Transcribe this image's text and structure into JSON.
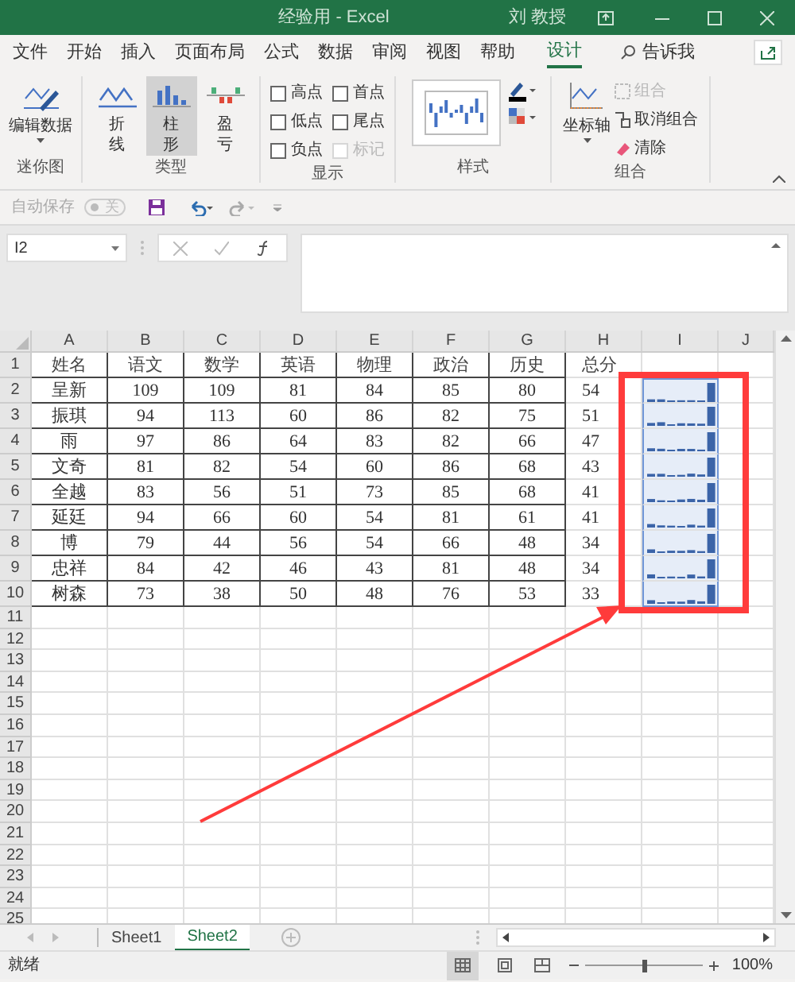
{
  "window": {
    "title": "经验用 - Excel",
    "user": "刘 教授"
  },
  "ribbon_tabs": [
    {
      "label": "文件",
      "selected": false
    },
    {
      "label": "开始",
      "selected": false
    },
    {
      "label": "插入",
      "selected": false
    },
    {
      "label": "页面布局",
      "selected": false
    },
    {
      "label": "公式",
      "selected": false
    },
    {
      "label": "数据",
      "selected": false
    },
    {
      "label": "审阅",
      "selected": false
    },
    {
      "label": "视图",
      "selected": false
    },
    {
      "label": "帮助",
      "selected": false
    },
    {
      "label": "设计",
      "selected": true
    }
  ],
  "tell_me": "告诉我",
  "sparkline_group": {
    "button": "编辑数据",
    "label": "迷你图"
  },
  "type_group": {
    "label": "类型",
    "types": [
      {
        "kind": "line",
        "label": "折线",
        "selected": false
      },
      {
        "kind": "column",
        "label": "柱形",
        "selected": true
      },
      {
        "kind": "winloss",
        "label": "盈亏",
        "selected": false
      }
    ]
  },
  "show_group": {
    "label": "显示",
    "options": [
      {
        "label": "高点",
        "checked": false,
        "disabled": false
      },
      {
        "label": "低点",
        "checked": false,
        "disabled": false
      },
      {
        "label": "负点",
        "checked": false,
        "disabled": false
      },
      {
        "label": "首点",
        "checked": false,
        "disabled": false
      },
      {
        "label": "尾点",
        "checked": false,
        "disabled": false
      },
      {
        "label": "标记",
        "checked": false,
        "disabled": true
      }
    ]
  },
  "style_group": {
    "label": "样式"
  },
  "group_group": {
    "label": "组合",
    "axis": "坐标轴",
    "items": [
      {
        "kind": "group",
        "label": "组合",
        "disabled": true
      },
      {
        "kind": "ungroup",
        "label": "取消组合",
        "disabled": false
      },
      {
        "kind": "clear",
        "label": "清除",
        "disabled": false
      }
    ]
  },
  "quick_access": {
    "autosave_label": "自动保存",
    "autosave_on": false,
    "autosave_state": "关"
  },
  "formula_bar": {
    "name_box": "I2"
  },
  "sheet": {
    "columns": [
      "A",
      "B",
      "C",
      "D",
      "E",
      "F",
      "G",
      "H",
      "I",
      "J"
    ],
    "rows": [
      {
        "number": "1",
        "cells": [
          "姓名",
          "语文",
          "数学",
          "英语",
          "物理",
          "政治",
          "历史",
          "总分"
        ]
      },
      {
        "number": "2",
        "cells": [
          "呈新",
          "109",
          "109",
          "81",
          "84",
          "85",
          "80",
          "54"
        ]
      },
      {
        "number": "3",
        "cells": [
          "振琪",
          "94",
          "113",
          "60",
          "86",
          "82",
          "75",
          "51"
        ]
      },
      {
        "number": "4",
        "cells": [
          "雨",
          "97",
          "86",
          "64",
          "83",
          "82",
          "66",
          "47"
        ]
      },
      {
        "number": "5",
        "cells": [
          "文奇",
          "81",
          "82",
          "54",
          "60",
          "86",
          "68",
          "43"
        ]
      },
      {
        "number": "6",
        "cells": [
          "全越",
          "83",
          "56",
          "51",
          "73",
          "85",
          "68",
          "41"
        ]
      },
      {
        "number": "7",
        "cells": [
          "延廷",
          "94",
          "66",
          "60",
          "54",
          "81",
          "61",
          "41"
        ]
      },
      {
        "number": "8",
        "cells": [
          "博",
          "79",
          "44",
          "56",
          "54",
          "66",
          "48",
          "34"
        ]
      },
      {
        "number": "9",
        "cells": [
          "忠祥",
          "84",
          "42",
          "46",
          "43",
          "81",
          "48",
          "34"
        ]
      },
      {
        "number": "10",
        "cells": [
          "树森",
          "73",
          "38",
          "50",
          "48",
          "76",
          "53",
          "33"
        ]
      }
    ],
    "empty_rows": [
      "11",
      "12",
      "13",
      "14",
      "15",
      "16",
      "17",
      "18",
      "19",
      "20",
      "21",
      "22",
      "23",
      "24",
      "25"
    ]
  },
  "sheet_tabs": [
    {
      "label": "Sheet1",
      "selected": false
    },
    {
      "label": "Sheet2",
      "selected": true
    }
  ],
  "status_bar": {
    "text": "就绪",
    "zoom": "100%",
    "zoom_level": {
      "level": 0.5
    }
  }
}
